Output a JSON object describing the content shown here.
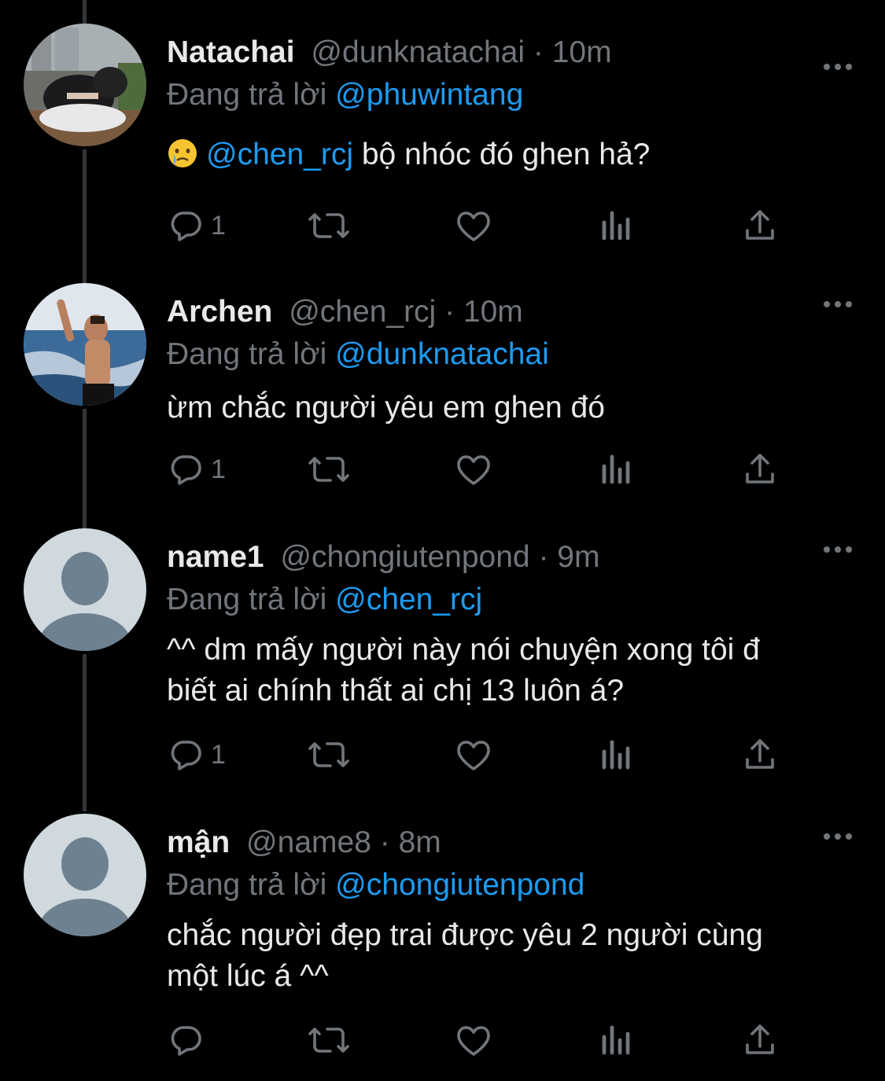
{
  "colors": {
    "background": "#000000",
    "text": "#e7e9ea",
    "muted": "#71767b",
    "link": "#1d9bf0",
    "thread": "#333639"
  },
  "tweets": [
    {
      "name": "Natachai",
      "handle": "@dunknatachai",
      "sep": "·",
      "time": "10m",
      "reply_prefix": "Đang trả lời",
      "reply_to": "@phuwintang",
      "emoji": "crying-face-icon",
      "mention": "@chen_rcj",
      "text": " bộ nhóc đó ghen hả?",
      "reply_count": "1"
    },
    {
      "name": "Archen",
      "handle": "@chen_rcj",
      "sep": "·",
      "time": "10m",
      "reply_prefix": "Đang trả lời",
      "reply_to": "@dunknatachai",
      "text": "ừm chắc người yêu em ghen đó",
      "reply_count": "1"
    },
    {
      "name": "name1",
      "handle": "@chongiutenpond",
      "sep": "·",
      "time": "9m",
      "reply_prefix": "Đang trả lời",
      "reply_to": "@chen_rcj",
      "text_line1": "^^ dm mấy người này nói chuyện xong tôi đ",
      "text_line2": "biết ai chính thất ai chị 13 luôn á?",
      "reply_count": "1"
    },
    {
      "name": "mận",
      "handle": "@name8",
      "sep": "·",
      "time": "8m",
      "reply_prefix": "Đang trả lời",
      "reply_to": "@chongiutenpond",
      "text_line1": "chắc người đẹp trai được yêu 2 người cùng",
      "text_line2": "một lúc á ^^",
      "reply_count": ""
    }
  ]
}
